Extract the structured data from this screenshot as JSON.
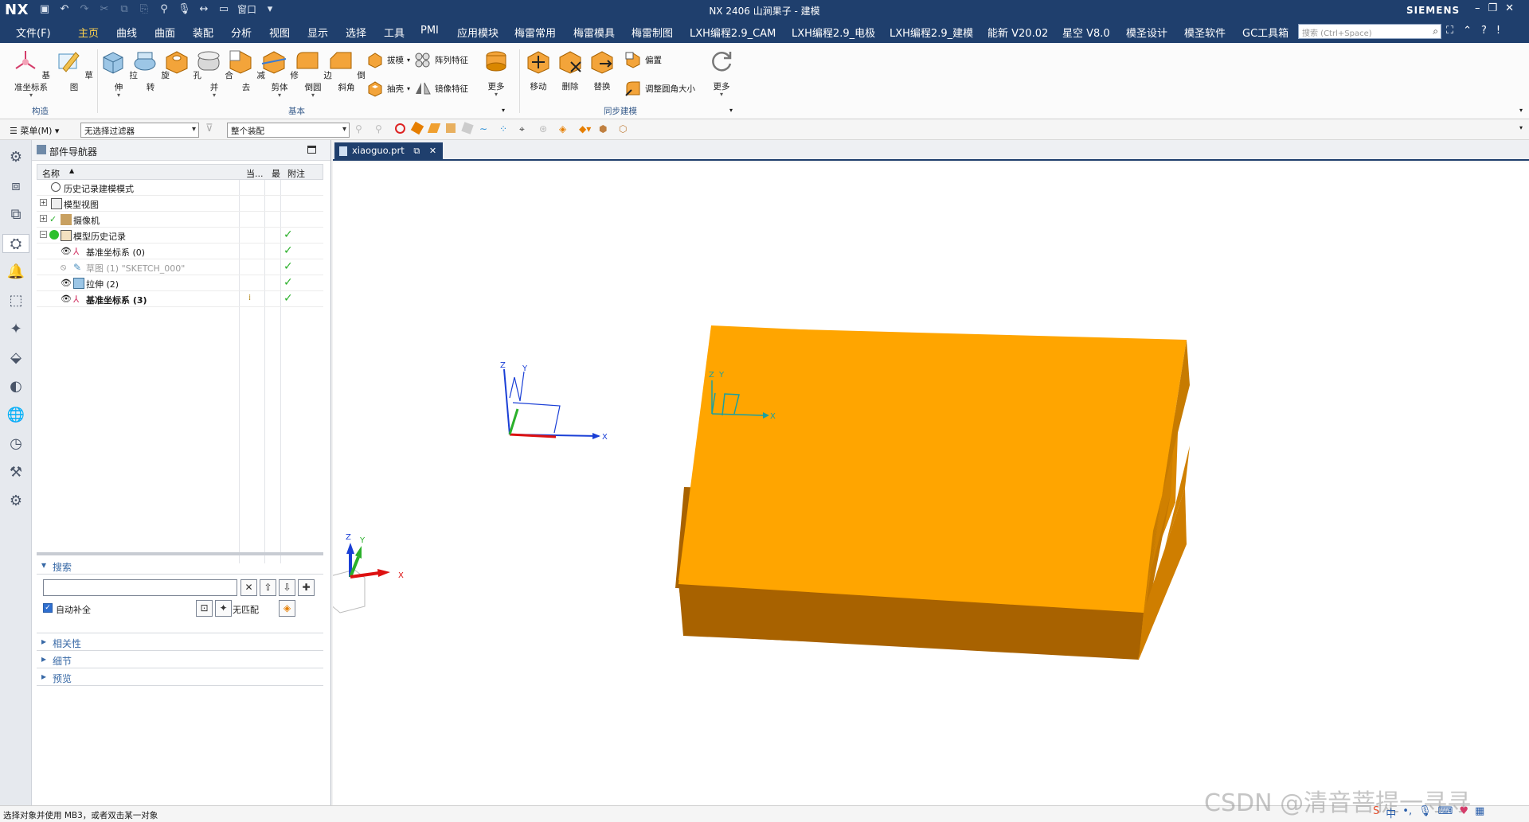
{
  "titlebar": {
    "logo": "NX",
    "window_menu": "窗口",
    "title": "NX 2406 山涧果子 - 建模",
    "brand": "SIEMENS"
  },
  "tabs": [
    "文件(F)",
    "主页",
    "曲线",
    "曲面",
    "装配",
    "分析",
    "视图",
    "显示",
    "选择",
    "工具",
    "PMI",
    "应用模块",
    "梅雷常用",
    "梅雷模具",
    "梅雷制图",
    "LXH编程2.9_CAM",
    "LXH编程2.9_电极",
    "LXH编程2.9_建模",
    "能新 V20.02",
    "星空 V8.0",
    "模圣设计",
    "模圣软件",
    "GC工具箱"
  ],
  "active_tab": "主页",
  "search": {
    "placeholder": "搜索 (Ctrl+Space)"
  },
  "ribbon": {
    "construct": {
      "datum_csys": "基准坐标系",
      "sketch": "草图",
      "label": "构造"
    },
    "basic": {
      "extrude": "拉伸",
      "revolve": "旋转",
      "hole": "孔",
      "unite": "合并",
      "subtract": "减去",
      "trim_body": "修剪体",
      "edge_blend": "边倒圆",
      "chamfer": "倒斜角",
      "draft": "拔模",
      "shell": "抽壳",
      "pattern_feature": "阵列特征",
      "mirror_feature": "镜像特征",
      "more": "更多",
      "label": "基本"
    },
    "sync": {
      "move": "移动",
      "delete": "删除",
      "replace": "替换",
      "offset": "偏置",
      "resize_blend": "调整圆角大小",
      "more": "更多",
      "label": "同步建模"
    }
  },
  "selbar": {
    "menu": "菜单(M)",
    "filter": "无选择过滤器",
    "scope": "整个装配"
  },
  "navigator": {
    "title": "部件导航器",
    "columns": {
      "name": "名称",
      "current": "当...",
      "latest": "最",
      "note": "附注"
    },
    "rows": [
      {
        "label": "历史记录建模模式"
      },
      {
        "label": "模型视图"
      },
      {
        "label": "摄像机"
      },
      {
        "label": "模型历史记录"
      },
      {
        "label": "基准坐标系 (0)"
      },
      {
        "label": "草图 (1) \"SKETCH_000\""
      },
      {
        "label": "拉伸 (2)"
      },
      {
        "label": "基准坐标系 (3)"
      }
    ],
    "search_section": "搜索",
    "auto_complete": "自动补全",
    "no_match": "无匹配",
    "relevance": "相关性",
    "details": "细节",
    "preview": "预览"
  },
  "viewport": {
    "tab": "xiaoguo.prt",
    "axis_labels": {
      "x": "X",
      "y": "Y",
      "z": "Z"
    }
  },
  "status": {
    "message": "选择对象并使用 MB3，或者双击某一对象"
  },
  "watermark": "CSDN @清音菩提一寻寻",
  "colors": {
    "accent": "#1f3f6d",
    "body_top": "#ffa500",
    "body_front": "#a86200",
    "body_side": "#d98700"
  }
}
